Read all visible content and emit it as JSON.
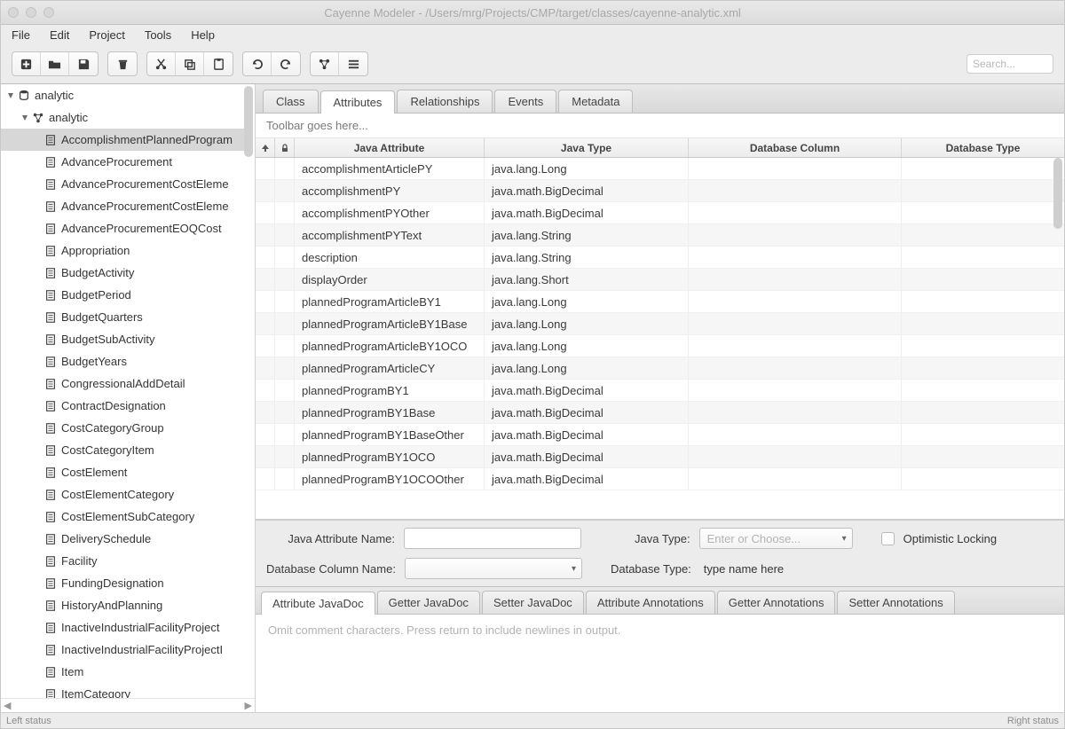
{
  "window": {
    "title": "Cayenne Modeler - /Users/mrg/Projects/CMP/target/classes/cayenne-analytic.xml"
  },
  "menubar": [
    "File",
    "Edit",
    "Project",
    "Tools",
    "Help"
  ],
  "search": {
    "placeholder": "Search..."
  },
  "tree": {
    "root": "analytic",
    "datamap": "analytic",
    "entities": [
      "AccomplishmentPlannedProgram",
      "AdvanceProcurement",
      "AdvanceProcurementCostEleme",
      "AdvanceProcurementCostEleme",
      "AdvanceProcurementEOQCost",
      "Appropriation",
      "BudgetActivity",
      "BudgetPeriod",
      "BudgetQuarters",
      "BudgetSubActivity",
      "BudgetYears",
      "CongressionalAddDetail",
      "ContractDesignation",
      "CostCategoryGroup",
      "CostCategoryItem",
      "CostElement",
      "CostElementCategory",
      "CostElementSubCategory",
      "DeliverySchedule",
      "Facility",
      "FundingDesignation",
      "HistoryAndPlanning",
      "InactiveIndustrialFacilityProject",
      "InactiveIndustrialFacilityProjectI",
      "Item",
      "ItemCategory"
    ],
    "selectedIndex": 0
  },
  "tabs": {
    "items": [
      "Class",
      "Attributes",
      "Relationships",
      "Events",
      "Metadata"
    ],
    "activeIndex": 1
  },
  "subToolbar": "Toolbar goes here...",
  "table": {
    "headers": {
      "inherit": "⬆",
      "lock": "🔒",
      "javaAttr": "Java Attribute",
      "javaType": "Java Type",
      "dbCol": "Database Column",
      "dbType": "Database Type"
    },
    "rows": [
      {
        "attr": "accomplishmentArticlePY",
        "type": "java.lang.Long"
      },
      {
        "attr": "accomplishmentPY",
        "type": "java.math.BigDecimal"
      },
      {
        "attr": "accomplishmentPYOther",
        "type": "java.math.BigDecimal"
      },
      {
        "attr": "accomplishmentPYText",
        "type": "java.lang.String"
      },
      {
        "attr": "description",
        "type": "java.lang.String"
      },
      {
        "attr": "displayOrder",
        "type": "java.lang.Short"
      },
      {
        "attr": "plannedProgramArticleBY1",
        "type": "java.lang.Long"
      },
      {
        "attr": "plannedProgramArticleBY1Base",
        "type": "java.lang.Long"
      },
      {
        "attr": "plannedProgramArticleBY1OCO",
        "type": "java.lang.Long"
      },
      {
        "attr": "plannedProgramArticleCY",
        "type": "java.lang.Long"
      },
      {
        "attr": "plannedProgramBY1",
        "type": "java.math.BigDecimal"
      },
      {
        "attr": "plannedProgramBY1Base",
        "type": "java.math.BigDecimal"
      },
      {
        "attr": "plannedProgramBY1BaseOther",
        "type": "java.math.BigDecimal"
      },
      {
        "attr": "plannedProgramBY1OCO",
        "type": "java.math.BigDecimal"
      },
      {
        "attr": "plannedProgramBY1OCOOther",
        "type": "java.math.BigDecimal"
      }
    ]
  },
  "form": {
    "javaAttrNameLabel": "Java Attribute Name:",
    "javaTypeLabel": "Java Type:",
    "javaTypePlaceholder": "Enter or Choose...",
    "optLockLabel": "Optimistic Locking",
    "dbColLabel": "Database Column Name:",
    "dbTypeLabel": "Database Type:",
    "dbTypeValue": "type name here"
  },
  "docTabs": {
    "items": [
      "Attribute JavaDoc",
      "Getter JavaDoc",
      "Setter JavaDoc",
      "Attribute Annotations",
      "Getter Annotations",
      "Setter Annotations"
    ],
    "activeIndex": 0
  },
  "docPlaceholder": "Omit comment characters.  Press return to include newlines in output.",
  "status": {
    "left": "Left status",
    "right": "Right status"
  }
}
